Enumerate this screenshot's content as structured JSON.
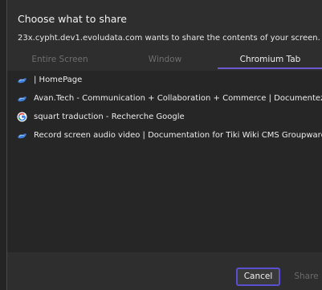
{
  "dialog": {
    "title": "Choose what to share",
    "subtitle": "23x.cypht.dev1.evoludata.com wants to share the contents of your screen."
  },
  "tabs": [
    {
      "label": "Entire Screen",
      "active": false
    },
    {
      "label": "Window",
      "active": false
    },
    {
      "label": "Chromium Tab",
      "active": true
    }
  ],
  "tab_list": [
    {
      "label": "| HomePage",
      "icon": "tiki-favicon-icon"
    },
    {
      "label": "Avan.Tech - Communication + Collaboration + Commerce | Documentez la nouv",
      "icon": "tiki-favicon-icon"
    },
    {
      "label": "squart traduction - Recherche Google",
      "icon": "google-favicon-icon"
    },
    {
      "label": "Record screen audio video | Documentation for Tiki Wiki CMS Groupware",
      "icon": "tiki-favicon-icon"
    }
  ],
  "buttons": {
    "cancel": "Cancel",
    "share": "Share"
  },
  "colors": {
    "accent": "#5b4fd1",
    "tab_underline": "#6a5acd",
    "background": "#2e2e2e",
    "list_background": "#262626"
  }
}
